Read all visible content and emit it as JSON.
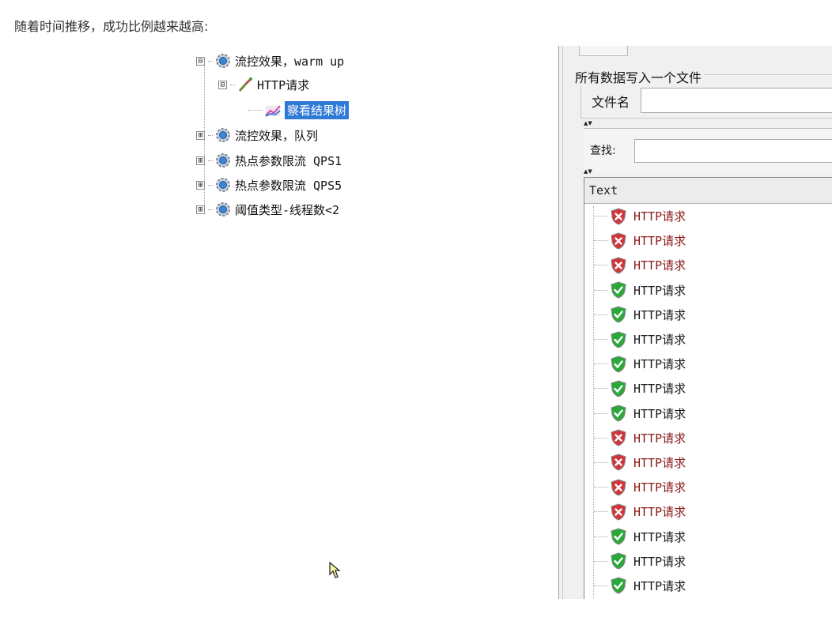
{
  "caption": "随着时间推移，成功比例越来越高:",
  "tree": {
    "items": [
      {
        "label": "流控效果，warm up",
        "expander": "⊟",
        "icon": "gear-icon"
      },
      {
        "label": "HTTP请求",
        "expander": "⊟",
        "icon": "sampler-icon"
      },
      {
        "label": "察看结果树",
        "expander": "",
        "icon": "listener-icon",
        "selected": true
      },
      {
        "label": "流控效果，队列",
        "expander": "⊞",
        "icon": "gear-icon"
      },
      {
        "label": "热点参数限流 QPS1",
        "expander": "⊞",
        "icon": "gear-icon"
      },
      {
        "label": "热点参数限流 QPS5",
        "expander": "⊞",
        "icon": "gear-icon"
      },
      {
        "label": "阈值类型-线程数<2",
        "expander": "⊞",
        "icon": "gear-icon"
      }
    ]
  },
  "panel": {
    "fieldset_legend": "所有数据写入一个文件",
    "filename_label": "文件名",
    "filename_value": "",
    "search_label": "查找:",
    "search_value": "",
    "results_header": "Text",
    "results": [
      {
        "label": "HTTP请求",
        "status": "fail"
      },
      {
        "label": "HTTP请求",
        "status": "fail"
      },
      {
        "label": "HTTP请求",
        "status": "fail"
      },
      {
        "label": "HTTP请求",
        "status": "ok"
      },
      {
        "label": "HTTP请求",
        "status": "ok"
      },
      {
        "label": "HTTP请求",
        "status": "ok"
      },
      {
        "label": "HTTP请求",
        "status": "ok"
      },
      {
        "label": "HTTP请求",
        "status": "ok"
      },
      {
        "label": "HTTP请求",
        "status": "ok"
      },
      {
        "label": "HTTP请求",
        "status": "fail"
      },
      {
        "label": "HTTP请求",
        "status": "fail"
      },
      {
        "label": "HTTP请求",
        "status": "fail"
      },
      {
        "label": "HTTP请求",
        "status": "fail"
      },
      {
        "label": "HTTP请求",
        "status": "ok"
      },
      {
        "label": "HTTP请求",
        "status": "ok"
      },
      {
        "label": "HTTP请求",
        "status": "ok"
      }
    ]
  },
  "colors": {
    "selection": "#2f7ad6",
    "success": "#2aa83a",
    "failure": "#d0363b",
    "failure_text": "#8b1a1a"
  }
}
